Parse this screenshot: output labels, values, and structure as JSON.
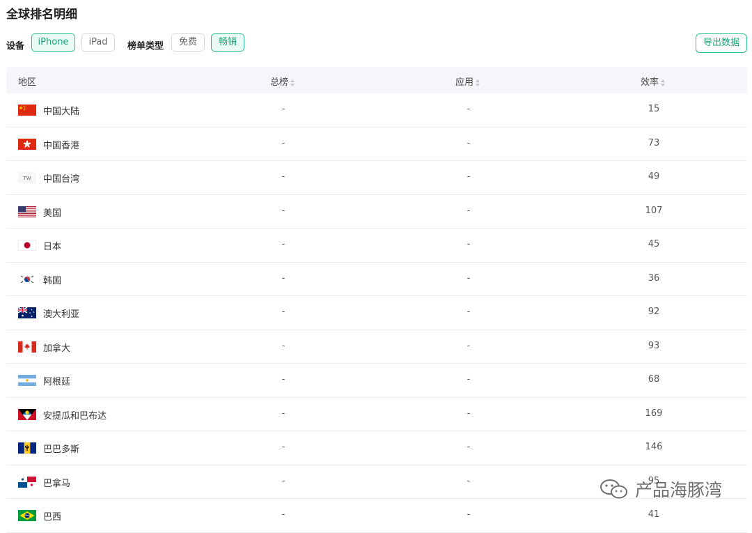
{
  "title": "全球排名明细",
  "filters": {
    "device_label": "设备",
    "devices": [
      {
        "label": "iPhone",
        "active": true
      },
      {
        "label": "iPad",
        "active": false
      }
    ],
    "chart_type_label": "榜单类型",
    "chart_types": [
      {
        "label": "免费",
        "active": false
      },
      {
        "label": "畅销",
        "active": true
      }
    ],
    "export_label": "导出数据"
  },
  "table": {
    "headers": [
      "地区",
      "总榜",
      "应用",
      "效率"
    ],
    "rows": [
      {
        "flag": "china-flag",
        "region": "中国大陆",
        "overall": "-",
        "apps": "-",
        "efficiency": "15"
      },
      {
        "flag": "hong-kong-flag",
        "region": "中国香港",
        "overall": "-",
        "apps": "-",
        "efficiency": "73"
      },
      {
        "flag": "taiwan-flag",
        "region": "中国台湾",
        "overall": "-",
        "apps": "-",
        "efficiency": "49",
        "flag_text": "TW"
      },
      {
        "flag": "usa-flag",
        "region": "美国",
        "overall": "-",
        "apps": "-",
        "efficiency": "107"
      },
      {
        "flag": "japan-flag",
        "region": "日本",
        "overall": "-",
        "apps": "-",
        "efficiency": "45"
      },
      {
        "flag": "korea-flag",
        "region": "韩国",
        "overall": "-",
        "apps": "-",
        "efficiency": "36"
      },
      {
        "flag": "australia-flag",
        "region": "澳大利亚",
        "overall": "-",
        "apps": "-",
        "efficiency": "92"
      },
      {
        "flag": "canada-flag",
        "region": "加拿大",
        "overall": "-",
        "apps": "-",
        "efficiency": "93"
      },
      {
        "flag": "argentina-flag",
        "region": "阿根廷",
        "overall": "-",
        "apps": "-",
        "efficiency": "68"
      },
      {
        "flag": "antigua-flag",
        "region": "安提瓜和巴布达",
        "overall": "-",
        "apps": "-",
        "efficiency": "169"
      },
      {
        "flag": "barbados-flag",
        "region": "巴巴多斯",
        "overall": "-",
        "apps": "-",
        "efficiency": "146"
      },
      {
        "flag": "panama-flag",
        "region": "巴拿马",
        "overall": "-",
        "apps": "-",
        "efficiency": "95"
      },
      {
        "flag": "brazil-flag",
        "region": "巴西",
        "overall": "-",
        "apps": "-",
        "efficiency": "41"
      }
    ]
  },
  "watermark": {
    "icon": "wechat-icon",
    "text": "产品海豚湾"
  },
  "colors": {
    "accent": "#2bbd8d",
    "header_bg": "#f4f6f9"
  }
}
